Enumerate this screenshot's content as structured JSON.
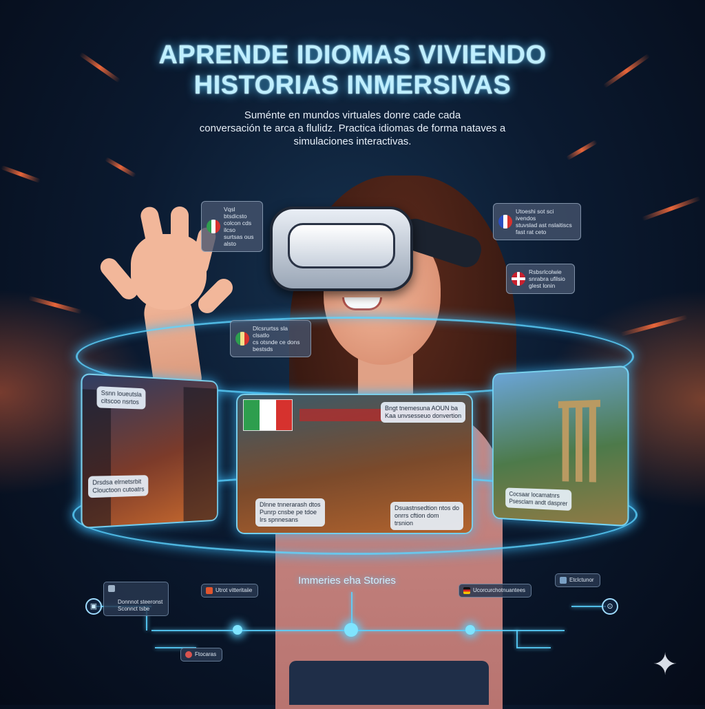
{
  "hero": {
    "title_line1": "APRENDE IDIOMAS VIVIENDO",
    "title_line2": "HISTORIAS INMERSIVAS",
    "subtitle_line1": "Suménte en mundos virtuales donre cade cada",
    "subtitle_line2": "conversación te arca a flulidz. Practica idiomas de forma nataves a",
    "subtitle_line3": "simulaciones interactivas."
  },
  "bubbles": {
    "italy_top": "Vqsl btsdicsto\ncolcon cds ilcso\nsurtsas ous alsto",
    "france": "Utoeshi sot sci ivendos\nstuvslad ast nslaitiscs\nfast rat ceto",
    "uk": "Rsbsrlcolwie\nsnrabra ufilsio\nglest lonin",
    "italy_mid": "Dlcsrurtss sla clsatlo\ncs otsnde ce dons\nbestsds"
  },
  "panels": {
    "asia_bubble": "Ssnn loueutsla\ncitscoo nsrtos",
    "asia_caption": "Drsdsa elrnetsrbit\nClouctoon cutoatrs",
    "cafe_bubble": "Bngt tnemesuna AOUN ba\nKaa unvsesseuo donvertion",
    "cafe_caption_left": "Dlnne tnnerarash dtos\nPunrp cnsbe pe tdoe\nIrs spnnesans",
    "cafe_caption_right": "Dsuastnsedtion ntos do\nonrrs cftion dom\ntrsnion",
    "ruins_caption": "Cocsaar locamatnrs\nPsesclam andt dasprer"
  },
  "timeline": {
    "label": "Immeries eha Stories",
    "chip1": "Donnnot steeronst\nSconnct tsbe",
    "chip2": "Utrot vitteritaiie",
    "chip3": "Ucorcurchotnuantees",
    "chip4": "Etclctunor",
    "chip5": "Ftocaras"
  },
  "colors": {
    "accent": "#5ad2ff",
    "italy_green": "#2e9e4e",
    "italy_red": "#d6322e",
    "france_blue": "#2a4dbf"
  }
}
